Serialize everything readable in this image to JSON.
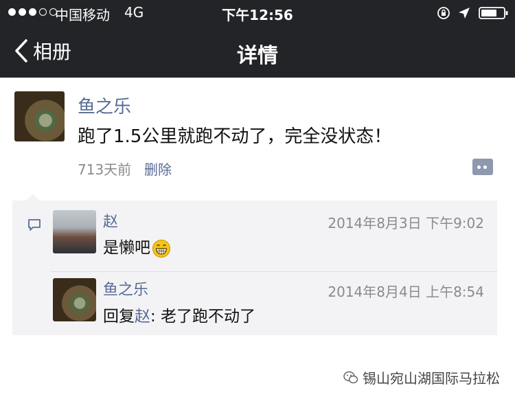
{
  "status_bar": {
    "signal_full": 3,
    "signal_empty": 2,
    "carrier": "中国移动",
    "network": "4G",
    "time": "下午12:56",
    "icons": [
      "lock-rotation-icon",
      "location-arrow-icon",
      "battery-icon"
    ]
  },
  "nav": {
    "back_label": "相册",
    "title": "详情"
  },
  "post": {
    "author": "鱼之乐",
    "text": "跑了1.5公里就跑不动了，完全没状态！",
    "time": "713天前",
    "delete_label": "删除",
    "more_icon": "comment-more-icon"
  },
  "comments": [
    {
      "author": "赵",
      "time": "2014年8月3日 下午9:02",
      "text": "是懒吧",
      "emoji": "grin-emoji-icon"
    },
    {
      "author": "鱼之乐",
      "time": "2014年8月4日 上午8:54",
      "reply_prefix": "回复",
      "reply_to": "赵",
      "text": ": 老了跑不动了"
    }
  ],
  "watermark": {
    "text": "锡山宛山湖国际马拉松",
    "icon": "wechat-official-account-icon"
  },
  "colors": {
    "nav_bg": "#232427",
    "link": "#586b95",
    "comment_bg": "#f3f3f5"
  }
}
